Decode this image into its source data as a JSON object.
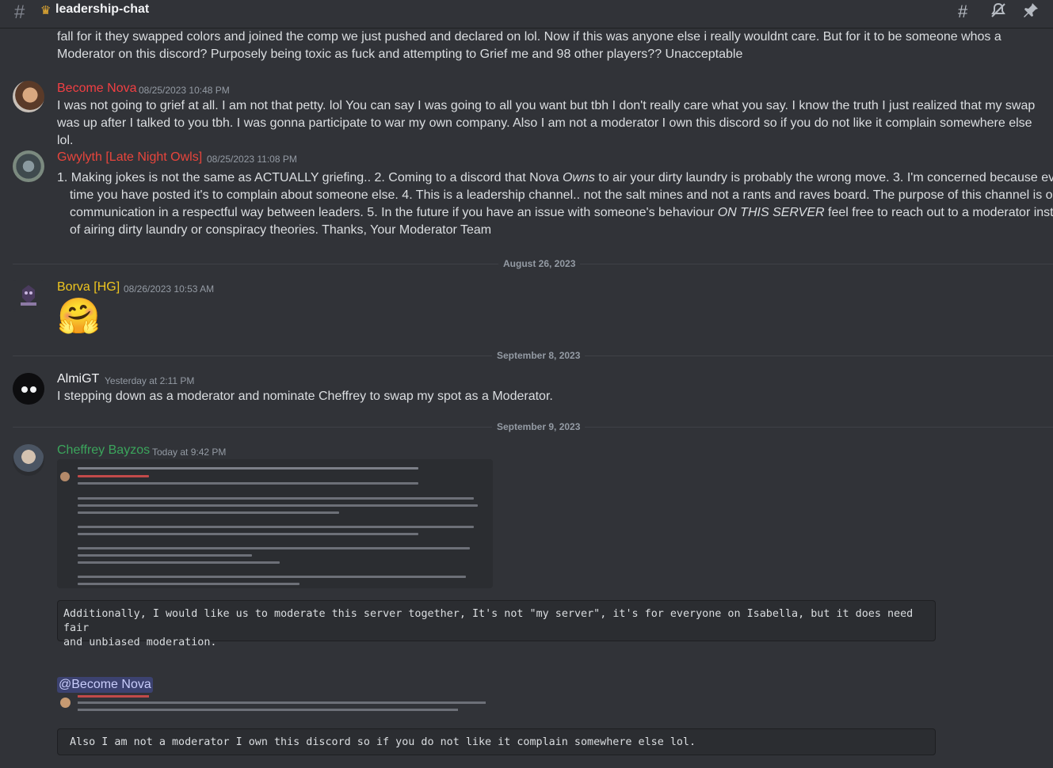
{
  "header": {
    "channel_name": "leadership-chat",
    "icons": [
      "threads-icon",
      "mute-icon",
      "pin-icon"
    ]
  },
  "messages": {
    "m0": {
      "text": "fall for it they swapped colors and joined the comp we just pushed and declared on lol. Now if this was anyone else i really wouldnt care. But for it to be someone whos a Moderator on this discord? Purposely being toxic as fuck and attempting to Grief me and 98 other players?? Unacceptable"
    },
    "m1": {
      "user": "Become Nova",
      "timestamp": "08/25/2023 10:48 PM",
      "name_color": "#f23f43",
      "text": "I was not going to grief at all. I am not that petty. lol You can say I was going to all you want but tbh I don't really care what you say. I know the truth I just realized that my swap was up after I talked to you tbh. I was gonna participate to war my own company. Also I am not a moderator I own this discord so if you do not like it complain somewhere else lol."
    },
    "m2": {
      "user": "Gwylyth [Late Night Owls]",
      "timestamp": "08/25/2023 11:08 PM",
      "name_color": "#e8453c",
      "text_a": "1. Making jokes is not the same as ACTUALLY griefing..   2. Coming to a discord that Nova ",
      "text_owns": "Owns",
      "text_b": " to air your dirty laundry is probably the wrong move.  3. I'm concerned because every",
      "line2": "time you have posted it's to complain about someone else.  4. This is a leadership channel.. not the salt mines and not a rants and raves board.  The purpose of this channel is open",
      "line3_a": "communication in a respectful way between leaders.  5. In the future if you have an issue with someone's behaviour ",
      "line3_em": "ON THIS SERVER",
      "line3_b": "  feel free to reach out to a moderator instead",
      "line4": "of airing dirty laundry or conspiracy theories.  Thanks, Your Moderator Team"
    },
    "divider1": "August 26, 2023",
    "m3": {
      "user": "Borva [HG]",
      "timestamp": "08/26/2023 10:53 AM",
      "name_color": "#f0c61f",
      "emoji": "🤗"
    },
    "divider2": "September 8, 2023",
    "m4": {
      "user": "AlmiGT",
      "timestamp": "Yesterday at 2:11 PM",
      "name_color": "#f2f3f5",
      "text": "I stepping down as a moderator and nominate Cheffrey to swap my spot as a Moderator."
    },
    "divider3": "September 9, 2023",
    "m5": {
      "user": "Cheffrey Bayzos",
      "timestamp": "Today at 9:42 PM",
      "name_color": "#3ba55c",
      "code1": "Additionally, I would like us to moderate this server together, It's not \"my server\", it's for everyone on Isabella, but it does need fair\nand unbiased moderation.",
      "mention": "@Become Nova",
      "code2": "Also I am not a moderator I own this discord so if you do not like it complain somewhere else lol."
    }
  }
}
